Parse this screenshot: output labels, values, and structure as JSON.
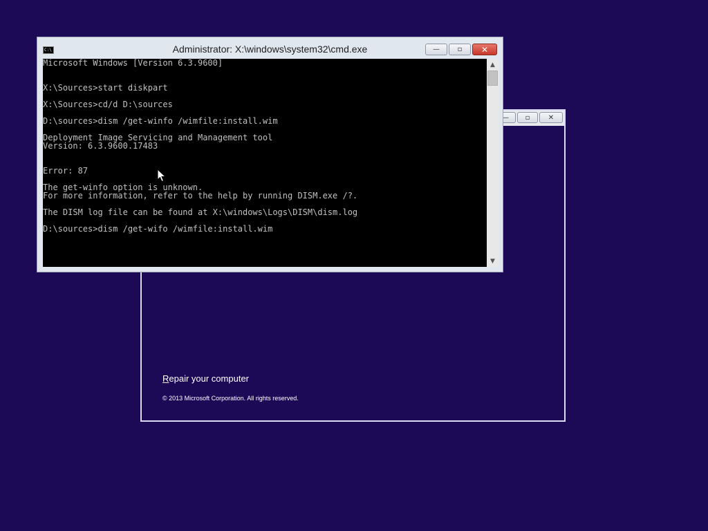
{
  "setup_window": {
    "repair_link_accesskey": "R",
    "repair_link_rest": "epair your computer",
    "copyright": "© 2013 Microsoft Corporation. All rights reserved.",
    "buttons": {
      "minimize": "—",
      "restore": "▫",
      "close": "✕"
    }
  },
  "cmd_window": {
    "title": "Administrator: X:\\windows\\system32\\cmd.exe",
    "icon_text": "C:\\",
    "buttons": {
      "minimize": "—",
      "restore": "▫",
      "close": "✕"
    },
    "console_lines": [
      "Microsoft Windows [Version 6.3.9600]",
      "",
      "",
      "X:\\Sources>start diskpart",
      "",
      "X:\\Sources>cd/d D:\\sources",
      "",
      "D:\\sources>dism /get-winfo /wimfile:install.wim",
      "",
      "Deployment Image Servicing and Management tool",
      "Version: 6.3.9600.17483",
      "",
      "",
      "Error: 87",
      "",
      "The get-winfo option is unknown.",
      "For more information, refer to the help by running DISM.exe /?.",
      "",
      "The DISM log file can be found at X:\\windows\\Logs\\DISM\\dism.log",
      "",
      "D:\\sources>dism /get-wifo /wimfile:install.wim"
    ],
    "scroll_up": "▲",
    "scroll_down": "▼"
  },
  "colors": {
    "desktop": "#1c0a57",
    "console_bg": "#000000",
    "console_fg": "#c0c0c0"
  }
}
